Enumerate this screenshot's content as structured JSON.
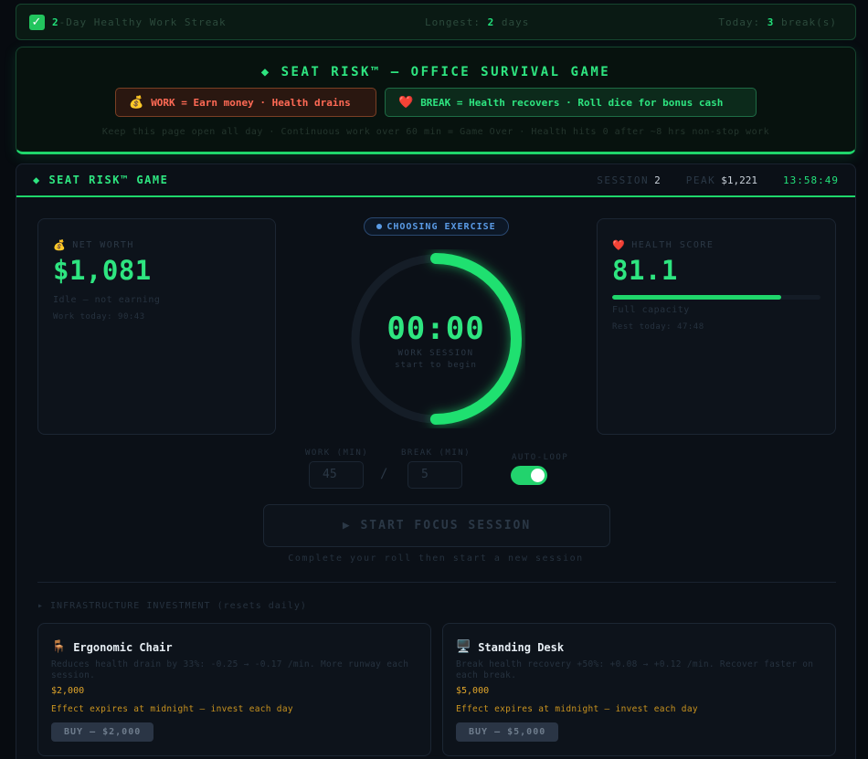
{
  "streak": {
    "check_icon": "✓",
    "days": "2",
    "text": "-Day Healthy Work Streak",
    "longest_label": "Longest:",
    "longest_value": "2",
    "longest_unit": "days",
    "today_label": "Today:",
    "today_value": "3",
    "today_unit": "break(s)"
  },
  "hero": {
    "title": "◆ SEAT RISK™ — OFFICE SURVIVAL GAME",
    "work_emoji": "💰",
    "work_text": "WORK = Earn money · Health drains",
    "break_emoji": "❤️",
    "break_text": "BREAK = Health recovers · Roll dice for bonus cash",
    "note": "Keep this page open all day · Continuous work over 60 min = Game Over · Health hits 0 after ~8 hrs non-stop work"
  },
  "game": {
    "title": "◆ SEAT RISK™ GAME",
    "session_label": "SESSION",
    "session_value": "2",
    "peak_label": "PEAK",
    "peak_value": "$1,221",
    "clock": "13:58:49"
  },
  "net_worth": {
    "emoji": "💰",
    "label": "NET WORTH",
    "value": "$1,081",
    "status": "Idle — not earning",
    "work_today": "Work today: 90:43"
  },
  "health": {
    "emoji": "❤️",
    "label": "HEALTH SCORE",
    "value": "81.1",
    "bar_fraction": 0.811,
    "status": "Full capacity",
    "rest_today": "Rest today: 47:48"
  },
  "timer": {
    "status": "CHOOSING EXERCISE",
    "time": "00:00",
    "mode": "WORK SESSION",
    "sub": "start to begin",
    "ring_fraction": 0.5
  },
  "controls": {
    "work_label": "WORK (MIN)",
    "work_value": "45",
    "slash": "/",
    "break_label": "BREAK (MIN)",
    "break_value": "5",
    "autoloop_label": "AUTO-LOOP",
    "start_label": "▶ START FOCUS SESSION",
    "hint": "Complete your roll then start a new session"
  },
  "infra": {
    "heading": "▸ INFRASTRUCTURE INVESTMENT (resets daily)",
    "items": [
      {
        "emoji": "🪑",
        "name": "Ergonomic Chair",
        "desc": "Reduces health drain by 33%: -0.25 → -0.17 /min. More runway each session.",
        "price": "$2,000",
        "expiry": "Effect expires at midnight — invest each day",
        "buy": "BUY — $2,000"
      },
      {
        "emoji": "🖥️",
        "name": "Standing Desk",
        "desc": "Break health recovery +50%: +0.08 → +0.12 /min. Recover faster on each break.",
        "price": "$5,000",
        "expiry": "Effect expires at midnight — invest each day",
        "buy": "BUY — $5,000"
      }
    ]
  },
  "colors": {
    "accent": "#2ee580",
    "work": "#ff6a55",
    "gold": "#e0a52a",
    "status_blue": "#5a9be6"
  }
}
